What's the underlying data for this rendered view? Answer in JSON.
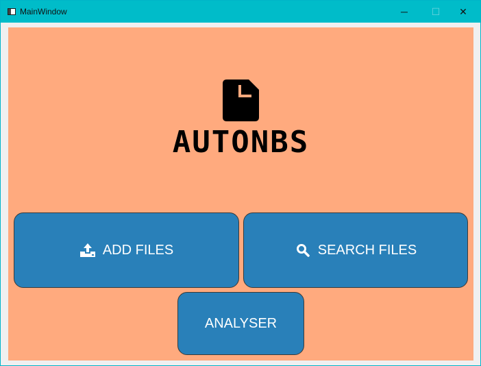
{
  "window": {
    "title": "MainWindow",
    "controls": {
      "minimize": "─",
      "maximize": "☐",
      "close": "✕"
    }
  },
  "colors": {
    "titlebar": "#00bcc9",
    "canvas": "#ffaa7e",
    "button": "#2980b9",
    "button_text": "#ffffff"
  },
  "logo": {
    "icon": "document-icon",
    "text": "AUTONBS"
  },
  "buttons": {
    "add_files": {
      "label": "ADD FILES",
      "icon": "upload-icon"
    },
    "search_files": {
      "label": "SEARCH FILES",
      "icon": "search-icon"
    },
    "analyser": {
      "label": "ANALYSER"
    }
  }
}
